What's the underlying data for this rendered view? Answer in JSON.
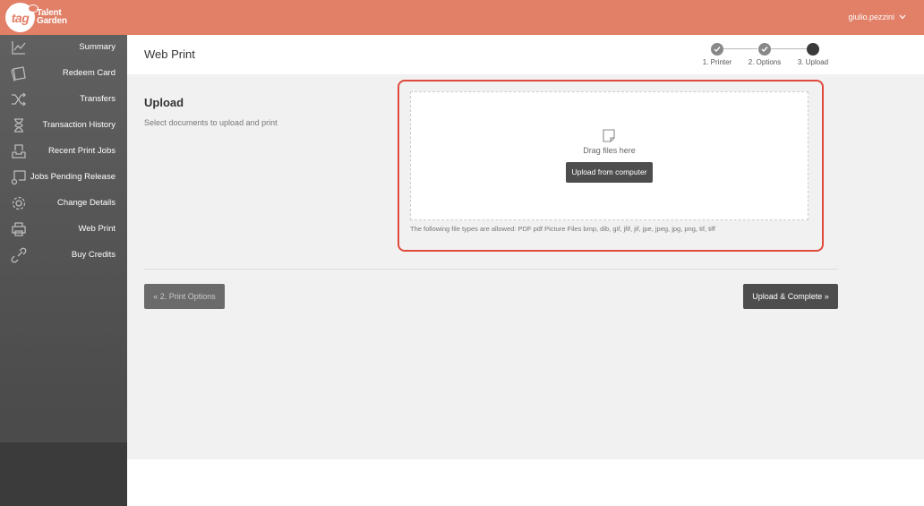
{
  "header": {
    "logo_text": "tag",
    "brand_line1": "Talent",
    "brand_line2": "Garden",
    "username": "giulio.pezzini"
  },
  "sidebar": {
    "items": [
      {
        "label": "Summary",
        "icon": "chart-icon"
      },
      {
        "label": "Redeem Card",
        "icon": "card-icon"
      },
      {
        "label": "Transfers",
        "icon": "shuffle-icon"
      },
      {
        "label": "Transaction History",
        "icon": "hourglass-icon"
      },
      {
        "label": "Recent Print Jobs",
        "icon": "inbox-icon"
      },
      {
        "label": "Jobs Pending Release",
        "icon": "pending-icon"
      },
      {
        "label": "Change Details",
        "icon": "gear-icon"
      },
      {
        "label": "Web Print",
        "icon": "printer-icon"
      },
      {
        "label": "Buy Credits",
        "icon": "link-icon"
      }
    ]
  },
  "page": {
    "title": "Web Print",
    "steps": [
      {
        "label": "1. Printer",
        "state": "done"
      },
      {
        "label": "2. Options",
        "state": "done"
      },
      {
        "label": "3. Upload",
        "state": "current"
      }
    ]
  },
  "upload": {
    "title": "Upload",
    "subtitle": "Select documents to upload and print",
    "drag_text": "Drag files here",
    "button_label": "Upload from computer",
    "allowed_text": "The following file types are allowed: PDF pdf Picture Files bmp, dib, gif, jfif, jif, jpe, jpeg, jpg, png, tif, tiff"
  },
  "footer": {
    "prev_label": "« 2. Print Options",
    "next_label": "Upload & Complete »"
  },
  "colors": {
    "header": "#e17f67",
    "sidebar": "#555555",
    "highlight": "#e04a3a"
  }
}
